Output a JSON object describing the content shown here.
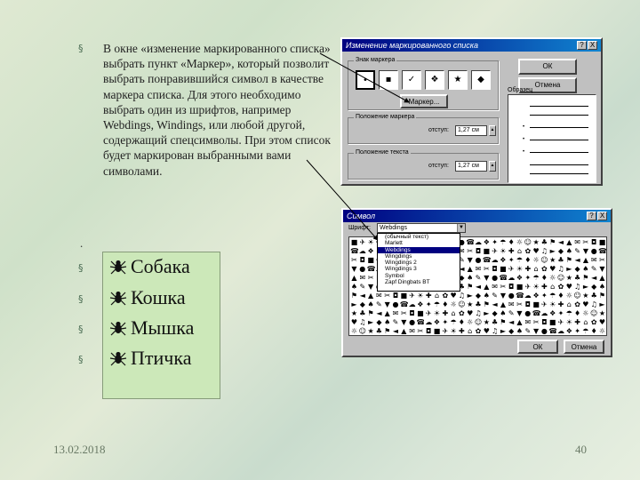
{
  "main_text": "В окне «изменение маркированного списка» выбрать пункт «Маркер», который позволит выбрать понравившийся символ в качестве маркера списка. Для этого необходимо выбрать один из шрифтов, например Webdings, Windings, или любой другой, содержащий спецсимволы. При этом список будет маркирован выбранными вами символами.",
  "separator": ".",
  "list_items": [
    "Собака",
    "Кошка",
    "Мышка",
    "Птичка"
  ],
  "footer": {
    "date": "13.02.2018",
    "page": "40"
  },
  "colors": {
    "accent_green": "#cce8b9",
    "bullet": "#4c6e55",
    "titlebar": "#000080"
  },
  "dialog1": {
    "title": "Изменение маркированного списка",
    "help_btn": "?",
    "close_btn": "X",
    "group_markers": "Знак маркера",
    "markers": [
      "•",
      "▪",
      "✓",
      "❖",
      "★",
      "◆"
    ],
    "ok": "ОК",
    "cancel": "Отмена",
    "marker_btn": "Маркер...",
    "group_pos_marker": "Положение маркера",
    "offset_label": "отступ:",
    "offset_value": "1,27 см",
    "group_pos_text": "Положение текста",
    "text_offset_label": "отступ:",
    "text_offset_value": "1,27 см",
    "preview_label": "Образец"
  },
  "dialog2": {
    "title": "Символ",
    "help_btn": "?",
    "close_btn": "X",
    "font_label": "Шрифт:",
    "font_value": "Webdings",
    "font_options": [
      "(обычный текст)",
      "Marlett",
      "Webdings",
      "Wingdings",
      "Wingdings 2",
      "Wingdings 3",
      "Symbol",
      "Zapf Dingbats BT"
    ],
    "ok": "ОК",
    "cancel": "Отмена"
  }
}
